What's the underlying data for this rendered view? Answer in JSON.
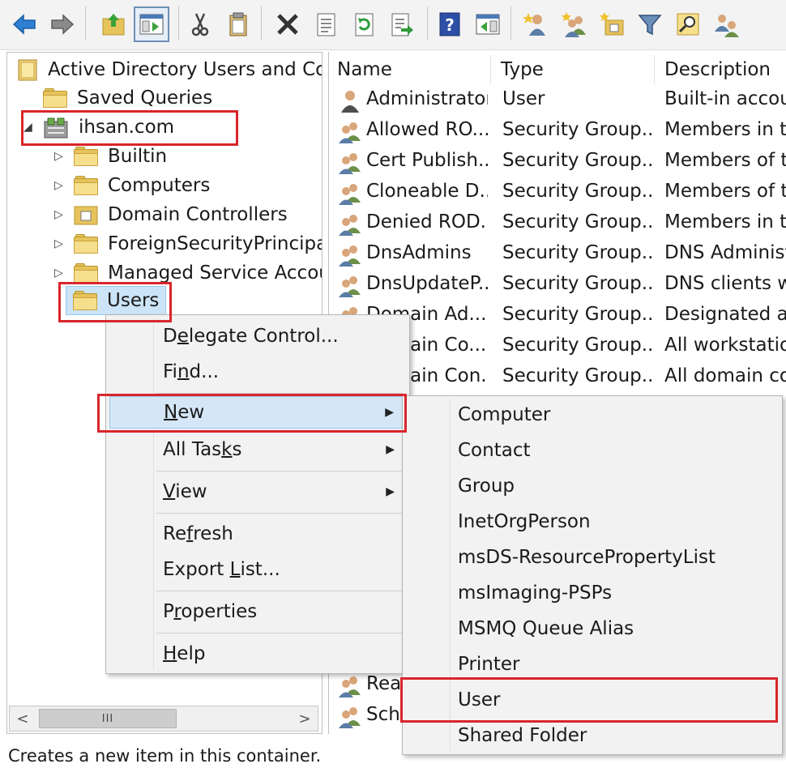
{
  "toolbar": {
    "buttons": [
      {
        "name": "back-arrow-icon"
      },
      {
        "name": "forward-arrow-icon"
      },
      {
        "name": "up-folder-icon"
      },
      {
        "name": "show-hide-console-tree-icon"
      },
      {
        "name": "cut-icon"
      },
      {
        "name": "copy-icon"
      },
      {
        "name": "delete-icon"
      },
      {
        "name": "properties-sheet-icon"
      },
      {
        "name": "refresh-icon"
      },
      {
        "name": "export-list-icon"
      },
      {
        "name": "help-icon"
      },
      {
        "name": "show-action-pane-icon"
      },
      {
        "name": "create-user-icon"
      },
      {
        "name": "create-group-icon"
      },
      {
        "name": "create-ou-icon"
      },
      {
        "name": "filter-icon"
      },
      {
        "name": "find-icon"
      },
      {
        "name": "add-to-group-icon"
      }
    ]
  },
  "tree": {
    "root": "Active Directory Users and Com",
    "saved_queries": "Saved Queries",
    "domain": "ihsan.com",
    "children": [
      "Builtin",
      "Computers",
      "Domain Controllers",
      "ForeignSecurityPrincipals",
      "Managed Service Accour",
      "Users"
    ]
  },
  "list": {
    "columns": [
      "Name",
      "Type",
      "Description"
    ],
    "rows": [
      {
        "name": "Administrator",
        "type": "User",
        "description": "Built-in accou"
      },
      {
        "name": "Allowed RO...",
        "type": "Security Group...",
        "description": "Members in th"
      },
      {
        "name": "Cert Publish...",
        "type": "Security Group...",
        "description": "Members of th"
      },
      {
        "name": "Cloneable D...",
        "type": "Security Group...",
        "description": "Members of th"
      },
      {
        "name": "Denied ROD...",
        "type": "Security Group...",
        "description": "Members in th"
      },
      {
        "name": "DnsAdmins",
        "type": "Security Group...",
        "description": "DNS Administ"
      },
      {
        "name": "DnsUpdateP...",
        "type": "Security Group...",
        "description": "DNS clients wh"
      },
      {
        "name": "Domain Ad...",
        "type": "Security Group...",
        "description": "Designated ad"
      },
      {
        "name": "Domain Co...",
        "type": "Security Group...",
        "description": "All workstation"
      },
      {
        "name": "Domain Con...",
        "type": "Security Group...",
        "description": "All domain co"
      }
    ],
    "partial_rows": [
      "Rea",
      "Sch"
    ]
  },
  "context_menu": {
    "items": [
      {
        "before": "D",
        "accel": "e",
        "after": "legate Control..."
      },
      {
        "before": "Fi",
        "accel": "n",
        "after": "d..."
      },
      {
        "before": "",
        "accel": "N",
        "after": "ew"
      },
      {
        "before": "All Tas",
        "accel": "k",
        "after": "s"
      },
      {
        "before": "",
        "accel": "V",
        "after": "iew"
      },
      {
        "before": "Re",
        "accel": "f",
        "after": "resh"
      },
      {
        "before": "Export ",
        "accel": "L",
        "after": "ist..."
      },
      {
        "before": "P",
        "accel": "r",
        "after": "operties"
      },
      {
        "before": "",
        "accel": "H",
        "after": "elp"
      }
    ]
  },
  "submenu": {
    "items": [
      "Computer",
      "Contact",
      "Group",
      "InetOrgPerson",
      "msDS-ResourcePropertyList",
      "msImaging-PSPs",
      "MSMQ Queue Alias",
      "Printer",
      "User",
      "Shared Folder"
    ]
  },
  "hscroll": {
    "thumb_label": "III",
    "left_arrow": "<",
    "right_arrow": ">"
  },
  "status": "Creates a new item in this container.",
  "colors": {
    "highlight_red": "#d9262c",
    "menu_highlight": "#d5e6f7",
    "selection": "#cce4f7"
  }
}
